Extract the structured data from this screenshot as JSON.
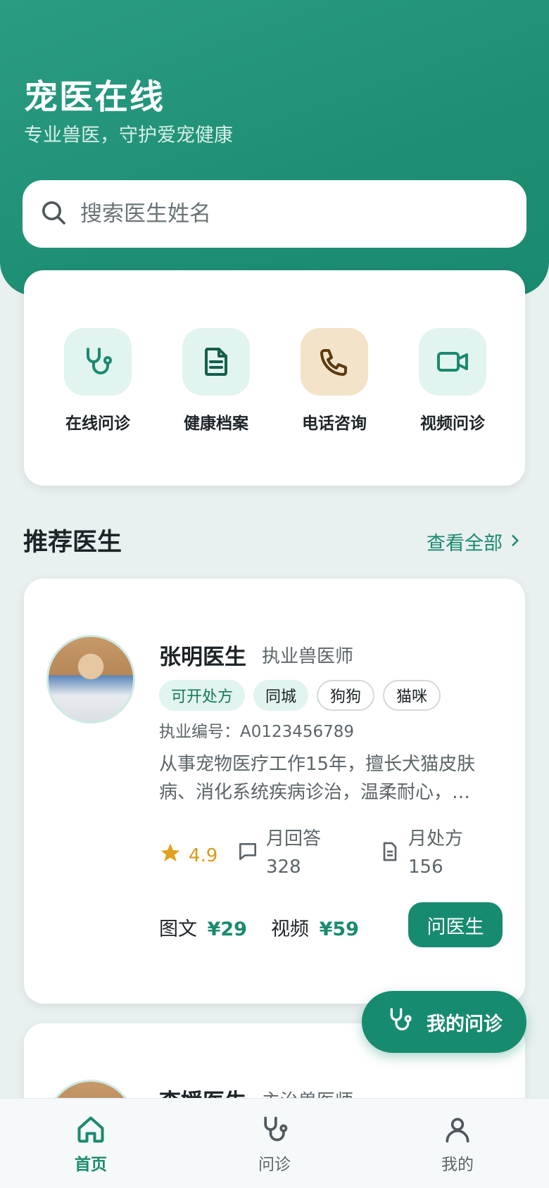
{
  "header": {
    "title": "宠医在线",
    "subtitle": "专业兽医，守护爱宠健康"
  },
  "search": {
    "placeholder": "搜索医生姓名"
  },
  "quick_actions": [
    {
      "label": "在线问诊",
      "icon": "stethoscope-icon"
    },
    {
      "label": "健康档案",
      "icon": "document-icon"
    },
    {
      "label": "电话咨询",
      "icon": "phone-icon"
    },
    {
      "label": "视频问诊",
      "icon": "video-icon"
    }
  ],
  "section": {
    "title": "推荐医生",
    "see_all": "查看全部"
  },
  "doctors": [
    {
      "name": "张明医生",
      "title": "执业兽医师",
      "tags": [
        "可开处方",
        "同城",
        "狗狗",
        "猫咪"
      ],
      "license": "执业编号：A0123456789",
      "intro": "从事宠物医疗工作15年，擅长犬猫皮肤病、消化系统疾病诊治，温柔耐心，…",
      "rating": "4.9",
      "answers_label": "月回答",
      "answers": "328",
      "rx_label": "月处方",
      "rx": "156",
      "price_text_label": "图文",
      "price_text": "¥29",
      "price_video_label": "视频",
      "price_video": "¥59",
      "ask_label": "问医生"
    },
    {
      "name": "李媛医生",
      "title": "主治兽医师"
    }
  ],
  "fab": {
    "label": "我的问诊"
  },
  "tabbar": [
    {
      "label": "首页",
      "icon": "home-icon",
      "active": true
    },
    {
      "label": "问诊",
      "icon": "stethoscope-icon",
      "active": false
    },
    {
      "label": "我的",
      "icon": "user-icon",
      "active": false
    }
  ],
  "colors": {
    "primary": "#178b6f",
    "header": "#1f8f74",
    "accent_warm": "#f3e3c8",
    "rating": "#d89a1a"
  }
}
